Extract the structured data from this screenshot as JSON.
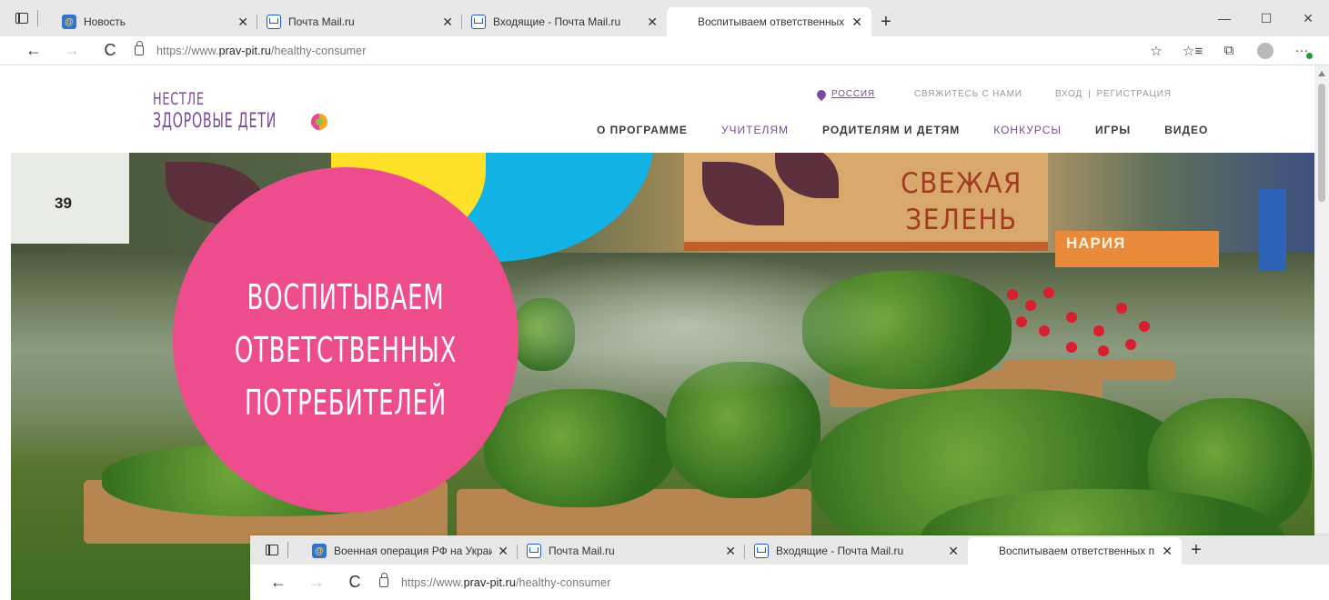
{
  "browser": {
    "tabs": [
      {
        "label": "Новость",
        "icon": "news-favicon",
        "active": false
      },
      {
        "label": "Почта Mail.ru",
        "icon": "mail-favicon",
        "active": false
      },
      {
        "label": "Входящие - Почта Mail.ru",
        "icon": "mail-favicon",
        "active": false
      },
      {
        "label": "Воспитываем ответственных п",
        "icon": "nestle-favicon",
        "active": true
      }
    ],
    "url": {
      "prefix": "https://www.",
      "host": "prav-pit.ru",
      "path": "/healthy-consumer"
    },
    "nav": {
      "back": "←",
      "forward": "→",
      "reload": "C"
    },
    "new_tab": "+",
    "window_controls": {
      "minimize": "—",
      "maximize": "☐",
      "close": "✕"
    }
  },
  "second_window": {
    "tabs": [
      {
        "label": "Военная операция РФ на Украи",
        "icon": "news-favicon"
      },
      {
        "label": "Почта Mail.ru",
        "icon": "mail-favicon"
      },
      {
        "label": "Входящие - Почта Mail.ru",
        "icon": "mail-favicon"
      },
      {
        "label": "Воспитываем ответственных п",
        "icon": "nestle-favicon"
      }
    ],
    "url": {
      "prefix": "https://www.",
      "host": "prav-pit.ru",
      "path": "/healthy-consumer"
    }
  },
  "site": {
    "logo": {
      "line1": "НЕСТЛЕ",
      "line2": "ЗДОРОВЫЕ ДЕТИ"
    },
    "utility": {
      "region": "РОССИЯ",
      "contact": "СВЯЖИТЕСЬ С НАМИ",
      "login": "ВХОД",
      "separator": "|",
      "register": "РЕГИСТРАЦИЯ"
    },
    "nav": [
      "О ПРОГРАММЕ",
      "УЧИТЕЛЯМ",
      "РОДИТЕЛЯМ И ДЕТЯМ",
      "КОНКУРСЫ",
      "ИГРЫ",
      "ВИДЕО"
    ],
    "hero": {
      "title_lines": [
        "ВОСПИТЫВАЕМ",
        "ОТВЕТСТВЕННЫХ",
        "ПОТРЕБИТЕЛЕЙ"
      ],
      "sign_lines": [
        "СВЕЖАЯ",
        "ЗЕЛЕНЬ"
      ],
      "price_tag": "39",
      "store_sign": "НАРИЯ"
    }
  },
  "colors": {
    "brand_purple": "#7a4b9a",
    "hero_pink": "#ee4d8d",
    "hero_blue": "#12b2e5",
    "hero_yellow": "#ffe12a"
  }
}
